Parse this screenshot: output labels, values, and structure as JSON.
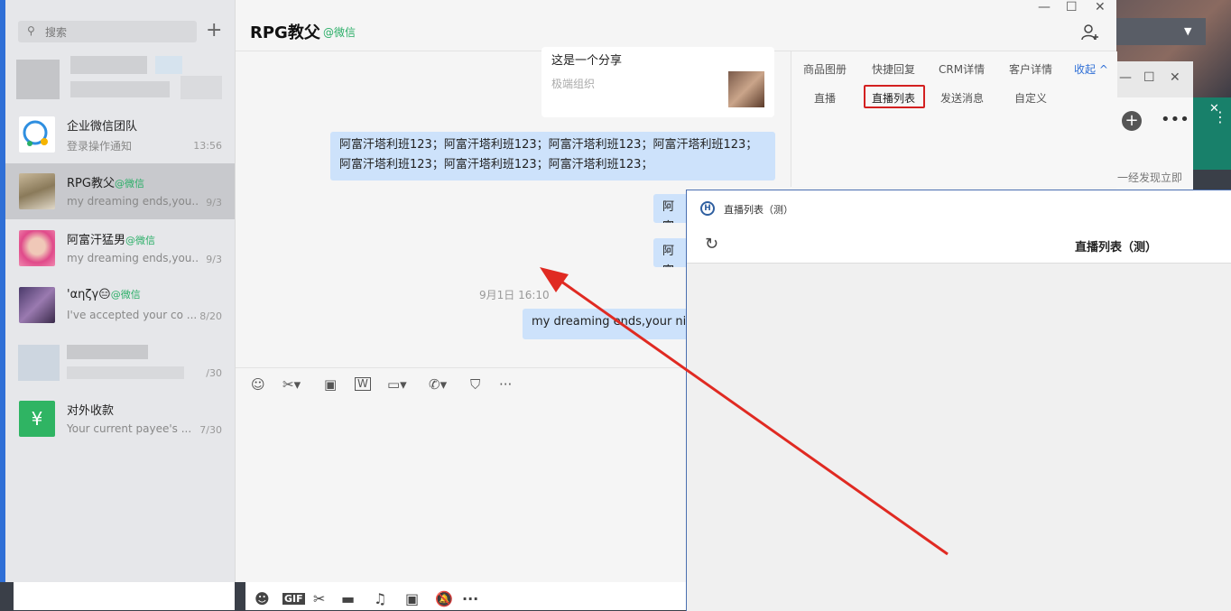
{
  "sidebar": {
    "search_placeholder": "搜索",
    "add_label": "+",
    "conversations": [
      {
        "name": "企业微信团队",
        "tag": "",
        "preview": "登录操作通知",
        "time": "13:56"
      },
      {
        "name": "RPG教父",
        "tag": "@微信",
        "preview": "my dreaming ends,you...",
        "time": "9/3"
      },
      {
        "name": "阿富汗猛男",
        "tag": "@微信",
        "preview": "my dreaming ends,you...",
        "time": "9/3"
      },
      {
        "name": "'αηζγ😑",
        "tag": "@微信",
        "preview": "I've accepted your co ...",
        "time": "8/20"
      },
      {
        "name": "",
        "tag": "",
        "preview": "",
        "time": "/30"
      },
      {
        "name": "对外收款",
        "tag": "",
        "preview": "Your current payee's ...",
        "time": "7/30"
      }
    ]
  },
  "chat": {
    "title": "RPG教父",
    "title_tag": "@微信",
    "share_title": "这是一个分享",
    "share_source": "极端组织",
    "messages": [
      "阿富汗塔利班123；阿富汗塔利班123；阿富汗塔利班123；阿富汗塔利班123；阿富汗塔利班123；阿富汗塔利班123；阿富汗塔利班123；",
      "阿富",
      "阿富",
      "my dreaming ends,your nigh"
    ],
    "time_mark": "9月1日 16:10"
  },
  "right_panel": {
    "row1": [
      "商品图册",
      "快捷回复",
      "CRM详情",
      "客户详情"
    ],
    "fold_label": "收起",
    "row2": [
      "直播",
      "直播列表",
      "发送消息",
      "自定义"
    ]
  },
  "popup": {
    "window_title": "直播列表（测）",
    "title": "直播列表（测）"
  },
  "background": {
    "cut_text": "一经发现立即"
  },
  "window_controls": {
    "minimize": "—",
    "maximize": "☐",
    "close": "✕"
  },
  "colors": {
    "accent": "#2f6fd6",
    "wechat_tag": "#2aae67",
    "bubble": "#cde2fb",
    "highlight_box": "#d32020",
    "arrow": "#e02a22"
  }
}
